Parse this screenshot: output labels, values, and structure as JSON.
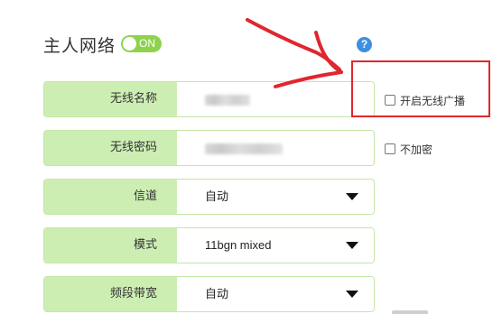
{
  "header": {
    "title": "主人网络",
    "toggle_label": "ON",
    "help_icon": "question-circle-icon"
  },
  "form": {
    "rows": [
      {
        "label": "无线名称",
        "value": "",
        "kind": "text-input-obscured"
      },
      {
        "label": "无线密码",
        "value": "",
        "kind": "text-input-obscured"
      },
      {
        "label": "信道",
        "value": "自动",
        "kind": "select"
      },
      {
        "label": "模式",
        "value": "11bgn mixed",
        "kind": "select"
      },
      {
        "label": "频段带宽",
        "value": "自动",
        "kind": "select"
      }
    ],
    "checkboxes": {
      "broadcast": {
        "label": "开启无线广播",
        "checked": false
      },
      "no_encrypt": {
        "label": "不加密",
        "checked": false
      }
    }
  },
  "colors": {
    "label_bg": "#cdeeb3",
    "row_border": "#c4e7a6",
    "toggle_on": "#8ed34e",
    "help_blue": "#3d8fe0",
    "annotation_red": "#e0262e"
  }
}
